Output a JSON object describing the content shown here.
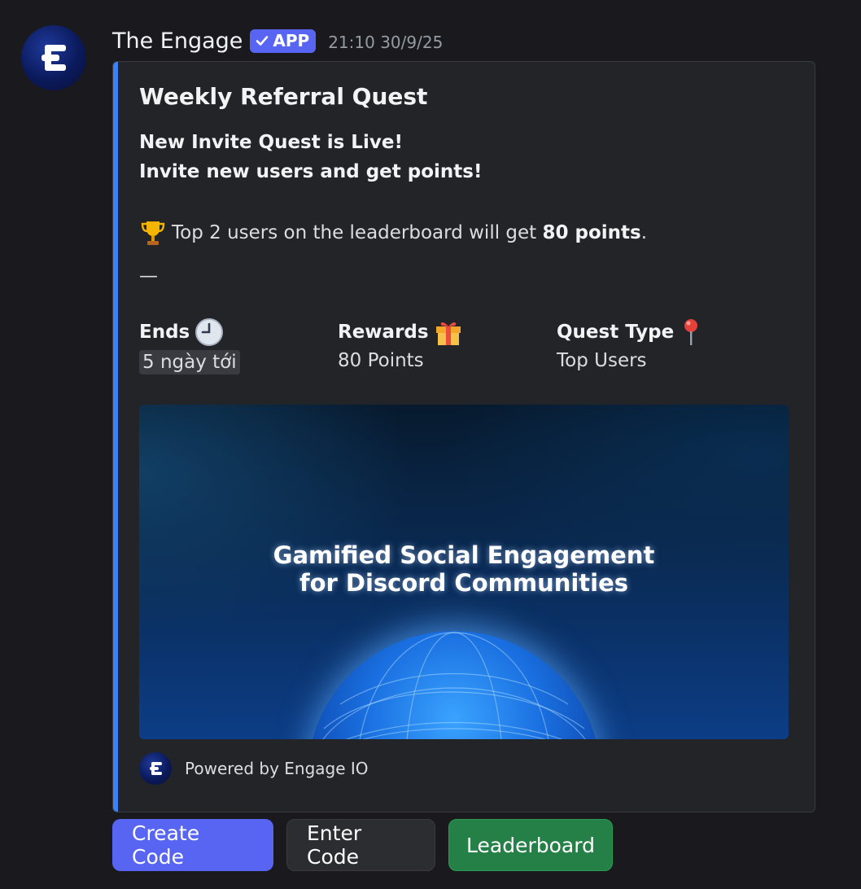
{
  "author": {
    "name": "The Engage",
    "badge": "APP",
    "timestamp": "21:10 30/9/25",
    "avatar_icon": "engage-logo-icon"
  },
  "embed": {
    "accent_color": "#3b82f6",
    "title": "Weekly Referral Quest",
    "description": {
      "line1": "New Invite Quest is Live!",
      "line2": "Invite new users and get points!",
      "trophy_text_before": "Top 2 users on the leaderboard will get ",
      "trophy_text_bold": "80 points",
      "trophy_text_after": ".",
      "separator": "—"
    },
    "fields": [
      {
        "name": "Ends",
        "icon": "clock-icon",
        "value": "5 ngày tới"
      },
      {
        "name": "Rewards",
        "icon": "gift-icon",
        "value": "80 Points"
      },
      {
        "name": "Quest Type",
        "icon": "pin-icon",
        "value": "Top Users"
      }
    ],
    "image": {
      "line1": "Gamified Social Engagement",
      "line2": "for Discord Communities"
    },
    "footer": {
      "text": "Powered by Engage IO"
    }
  },
  "buttons": {
    "create": "Create Code",
    "enter": "Enter Code",
    "leaderboard": "Leaderboard"
  },
  "colors": {
    "primary": "#5865f2",
    "success": "#248046",
    "background": "#1a1a1e"
  }
}
